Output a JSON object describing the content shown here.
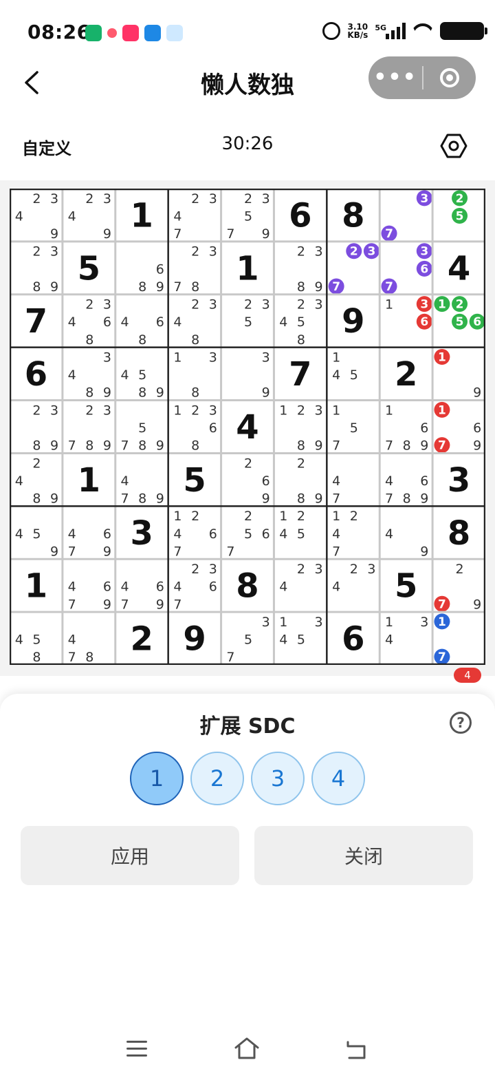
{
  "status_bar": {
    "time": "08:26",
    "net_speed_value": "3.10",
    "net_speed_unit": "KB/s",
    "network": "5G"
  },
  "header": {
    "title": "懒人数独",
    "more_label": "•••"
  },
  "info_bar": {
    "mode": "自定义",
    "timer": "30:26"
  },
  "board": {
    "givens": [
      [
        0,
        0,
        1,
        0,
        0,
        6,
        8,
        0,
        0
      ],
      [
        0,
        5,
        0,
        0,
        1,
        0,
        0,
        0,
        4
      ],
      [
        7,
        0,
        0,
        0,
        0,
        0,
        9,
        0,
        0
      ],
      [
        6,
        0,
        0,
        0,
        0,
        7,
        0,
        2,
        0
      ],
      [
        0,
        0,
        0,
        0,
        4,
        0,
        0,
        0,
        0
      ],
      [
        0,
        1,
        0,
        5,
        0,
        0,
        0,
        0,
        3
      ],
      [
        0,
        0,
        3,
        0,
        0,
        0,
        0,
        0,
        8
      ],
      [
        1,
        0,
        0,
        0,
        8,
        0,
        0,
        5,
        0
      ],
      [
        0,
        0,
        2,
        9,
        0,
        0,
        6,
        0,
        0
      ]
    ],
    "candidates": [
      [
        [
          2,
          3,
          4,
          9
        ],
        [
          2,
          3,
          4,
          9
        ],
        [],
        [
          2,
          3,
          4,
          7
        ],
        [
          2,
          3,
          5,
          7,
          9
        ],
        [],
        [],
        [
          3,
          7
        ],
        [
          2,
          5
        ]
      ],
      [
        [
          2,
          3,
          8,
          9
        ],
        [],
        [
          6,
          8,
          9
        ],
        [
          2,
          3,
          7,
          8
        ],
        [],
        [
          2,
          3,
          8,
          9
        ],
        [
          2,
          3,
          7
        ],
        [
          3,
          6,
          7
        ],
        []
      ],
      [
        [],
        [
          2,
          3,
          4,
          6,
          8
        ],
        [
          4,
          6,
          8
        ],
        [
          2,
          3,
          4,
          8
        ],
        [
          2,
          3,
          5
        ],
        [
          2,
          3,
          4,
          5,
          8
        ],
        [],
        [
          1,
          3,
          6
        ],
        [
          1,
          2,
          5,
          6
        ]
      ],
      [
        [],
        [
          3,
          4,
          8,
          9
        ],
        [
          4,
          5,
          8,
          9
        ],
        [
          1,
          3,
          8
        ],
        [
          3,
          9
        ],
        [],
        [
          1,
          4,
          5
        ],
        [],
        [
          1,
          9
        ]
      ],
      [
        [
          2,
          3,
          8,
          9
        ],
        [
          2,
          3,
          7,
          8,
          9
        ],
        [
          5,
          7,
          8,
          9
        ],
        [
          1,
          2,
          3,
          6,
          8
        ],
        [],
        [
          1,
          2,
          3,
          8,
          9
        ],
        [
          1,
          5,
          7
        ],
        [
          1,
          6,
          7,
          8,
          9
        ],
        [
          1,
          6,
          7,
          9
        ]
      ],
      [
        [
          2,
          4,
          8,
          9
        ],
        [],
        [
          4,
          7,
          8,
          9
        ],
        [],
        [
          2,
          6,
          9
        ],
        [
          2,
          8,
          9
        ],
        [
          4,
          7
        ],
        [
          4,
          6,
          7,
          8,
          9
        ],
        []
      ],
      [
        [
          4,
          5,
          9
        ],
        [
          4,
          6,
          7,
          9
        ],
        [],
        [
          1,
          2,
          4,
          6,
          7
        ],
        [
          2,
          5,
          6,
          7
        ],
        [
          1,
          2,
          4,
          5
        ],
        [
          1,
          2,
          4,
          7
        ],
        [
          4,
          9
        ],
        []
      ],
      [
        [],
        [
          4,
          6,
          7,
          9
        ],
        [
          4,
          6,
          7,
          9
        ],
        [
          2,
          3,
          4,
          6,
          7
        ],
        [],
        [
          2,
          3,
          4
        ],
        [
          2,
          3,
          4
        ],
        [],
        [
          2,
          7,
          9
        ]
      ],
      [
        [
          4,
          5,
          8
        ],
        [
          4,
          7,
          8
        ],
        [],
        [],
        [
          3,
          5,
          7
        ],
        [
          1,
          3,
          4,
          5
        ],
        [],
        [
          1,
          3,
          4
        ],
        [
          1,
          7
        ]
      ]
    ],
    "highlights": [
      {
        "cell": [
          0,
          7
        ],
        "digit": 3,
        "color": "#7c4ddf"
      },
      {
        "cell": [
          0,
          7
        ],
        "digit": 7,
        "color": "#7c4ddf"
      },
      {
        "cell": [
          0,
          8
        ],
        "digit": 2,
        "color": "#2fb34a"
      },
      {
        "cell": [
          0,
          8
        ],
        "digit": 5,
        "color": "#2fb34a"
      },
      {
        "cell": [
          1,
          6
        ],
        "digit": 2,
        "color": "#7c4ddf"
      },
      {
        "cell": [
          1,
          6
        ],
        "digit": 3,
        "color": "#7c4ddf"
      },
      {
        "cell": [
          1,
          6
        ],
        "digit": 7,
        "color": "#7c4ddf"
      },
      {
        "cell": [
          1,
          7
        ],
        "digit": 3,
        "color": "#7c4ddf"
      },
      {
        "cell": [
          1,
          7
        ],
        "digit": 6,
        "color": "#7c4ddf"
      },
      {
        "cell": [
          1,
          7
        ],
        "digit": 7,
        "color": "#7c4ddf"
      },
      {
        "cell": [
          2,
          7
        ],
        "digit": 3,
        "color": "#e53935"
      },
      {
        "cell": [
          2,
          7
        ],
        "digit": 6,
        "color": "#e53935"
      },
      {
        "cell": [
          2,
          8
        ],
        "digit": 1,
        "color": "#2fb34a"
      },
      {
        "cell": [
          2,
          8
        ],
        "digit": 2,
        "color": "#2fb34a"
      },
      {
        "cell": [
          2,
          8
        ],
        "digit": 5,
        "color": "#2fb34a"
      },
      {
        "cell": [
          2,
          8
        ],
        "digit": 6,
        "color": "#2fb34a"
      },
      {
        "cell": [
          3,
          8
        ],
        "digit": 1,
        "color": "#e53935"
      },
      {
        "cell": [
          4,
          8
        ],
        "digit": 1,
        "color": "#e53935"
      },
      {
        "cell": [
          4,
          8
        ],
        "digit": 7,
        "color": "#e53935"
      },
      {
        "cell": [
          7,
          8
        ],
        "digit": 7,
        "color": "#e53935"
      },
      {
        "cell": [
          8,
          8
        ],
        "digit": 1,
        "color": "#2b66d8"
      },
      {
        "cell": [
          8,
          8
        ],
        "digit": 7,
        "color": "#2b66d8"
      }
    ]
  },
  "toolbar": {
    "badge_count": "4"
  },
  "sheet": {
    "title": "扩展 SDC",
    "help": "?",
    "levels": [
      "1",
      "2",
      "3",
      "4"
    ],
    "apply_label": "应用",
    "close_label": "关闭"
  }
}
